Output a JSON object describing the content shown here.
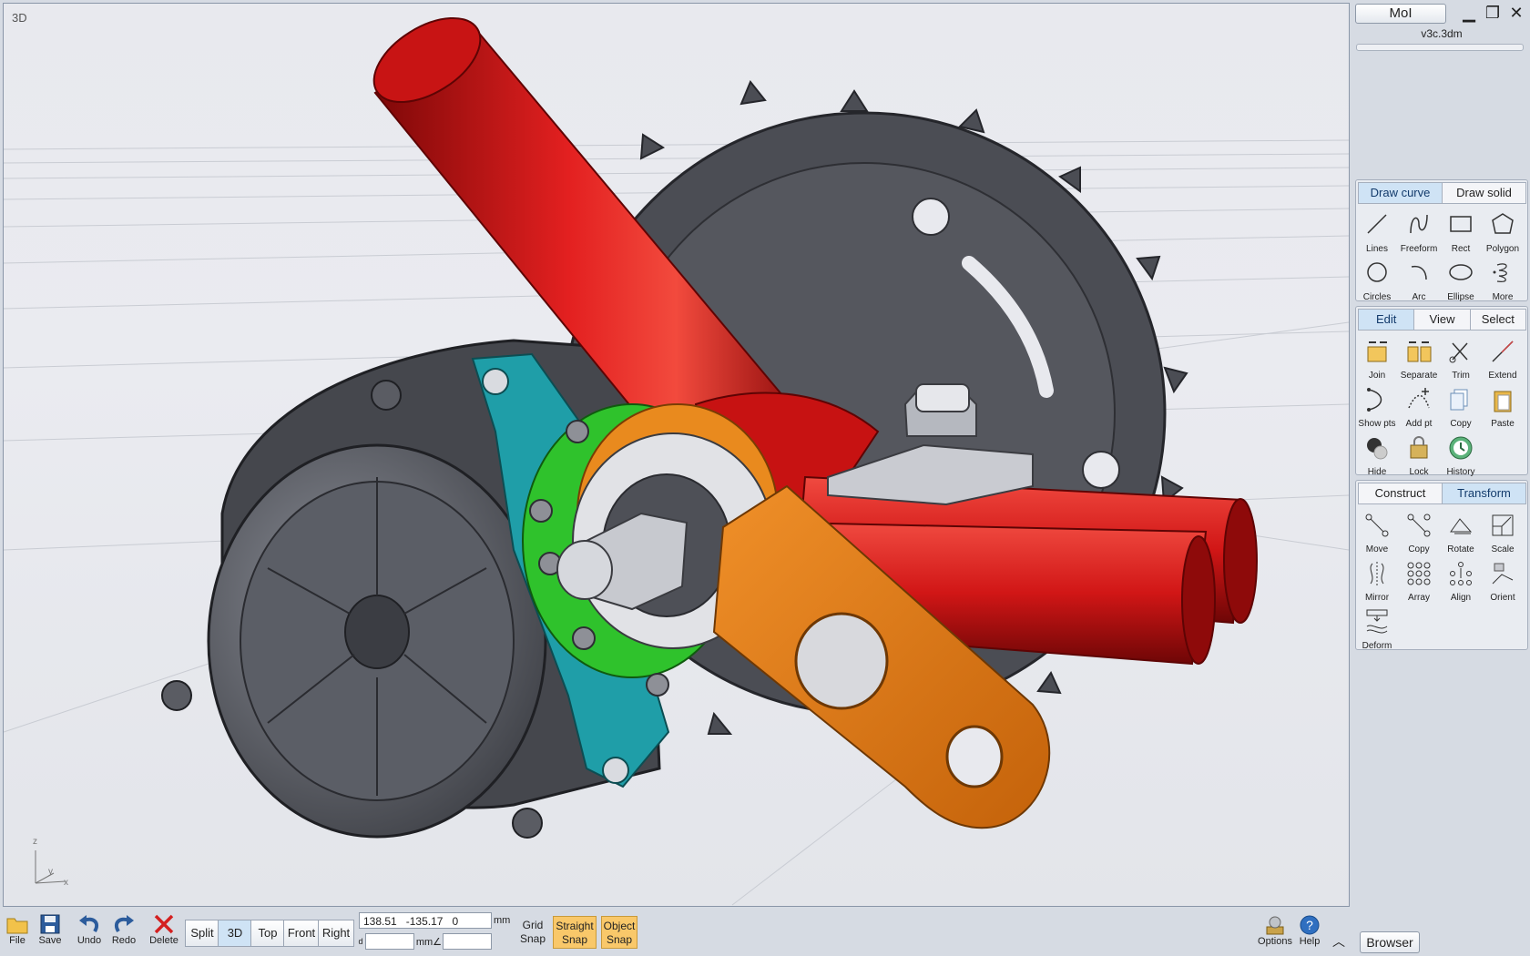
{
  "viewport": {
    "label": "3D",
    "axis_z": "z",
    "axis_y": "y",
    "axis_x": "x"
  },
  "app": {
    "name": "MoI",
    "filename": "v3c.3dm"
  },
  "window_controls": {
    "minimize": "minimize-icon",
    "maximize": "maximize-icon",
    "close": "close-icon"
  },
  "draw_group": {
    "tabs": [
      {
        "label": "Draw curve",
        "active": true
      },
      {
        "label": "Draw solid",
        "active": false
      }
    ],
    "tools": [
      "Lines",
      "Freeform",
      "Rect",
      "Polygon",
      "Circles",
      "Arc",
      "Ellipse",
      "More"
    ]
  },
  "edit_group": {
    "tabs": [
      {
        "label": "Edit",
        "active": true
      },
      {
        "label": "View",
        "active": false
      },
      {
        "label": "Select",
        "active": false
      }
    ],
    "tools": [
      "Join",
      "Separate",
      "Trim",
      "Extend",
      "Show pts",
      "Add pt",
      "Copy",
      "Paste",
      "Hide",
      "Lock",
      "History"
    ]
  },
  "transform_group": {
    "tabs": [
      {
        "label": "Construct",
        "active": false
      },
      {
        "label": "Transform",
        "active": true
      }
    ],
    "tools": [
      "Move",
      "Copy",
      "Rotate",
      "Scale",
      "Mirror",
      "Array",
      "Align",
      "Orient",
      "Deform"
    ]
  },
  "bottom": {
    "file": "File",
    "save": "Save",
    "undo": "Undo",
    "redo": "Redo",
    "delete": "Delete",
    "views": [
      {
        "label": "Split",
        "active": false
      },
      {
        "label": "3D",
        "active": true
      },
      {
        "label": "Top",
        "active": false
      },
      {
        "label": "Front",
        "active": false
      },
      {
        "label": "Right",
        "active": false
      }
    ],
    "coord_x": "138.51",
    "coord_y": "-135.17",
    "coord_z": "0",
    "unit": "mm",
    "dist_label": "d",
    "dist_unit": "mm",
    "angle_label": "∠",
    "grid_snap": [
      "Grid",
      "Snap"
    ],
    "straight_snap": [
      "Straight",
      "Snap"
    ],
    "object_snap": [
      "Object",
      "Snap"
    ],
    "options": "Options",
    "help": "Help",
    "browser": "Browser"
  },
  "colors": {
    "accent_tab": "#cfe3f5",
    "snap_on": "#f9c86a",
    "tube": "#d41414",
    "crank": "#e07a12",
    "teal": "#1f9ea8",
    "green": "#2fc22c"
  }
}
